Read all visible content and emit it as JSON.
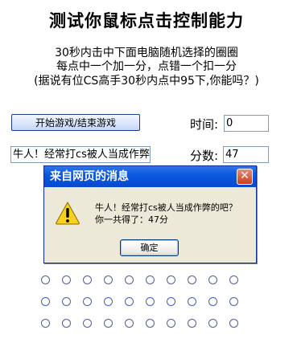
{
  "page": {
    "title": "测试你鼠标点击控制能力",
    "desc_line1": "30秒内击中下面电脑随机选择的圈圈",
    "desc_line2": "每点中一个加一分，点错一个扣一分",
    "desc_line3": "(据说有位CS高手30秒内点中95下,你能吗？)"
  },
  "controls": {
    "start_button": "开始游戏/结束游戏",
    "time_label": "时间:",
    "time_value": "0",
    "score_label": "分数:",
    "score_value": "47",
    "message_value": "牛人！经常打cs被人当成作弊"
  },
  "dialog": {
    "title": "来自网页的消息",
    "close_icon": "close-icon",
    "warning_icon": "warning-icon",
    "line1": "牛人！经常打cs被人当成作弊的吧？",
    "line2": "你一共得了：47分",
    "ok_label": "确定"
  },
  "grid": {
    "rows": 3,
    "cols": 10
  }
}
